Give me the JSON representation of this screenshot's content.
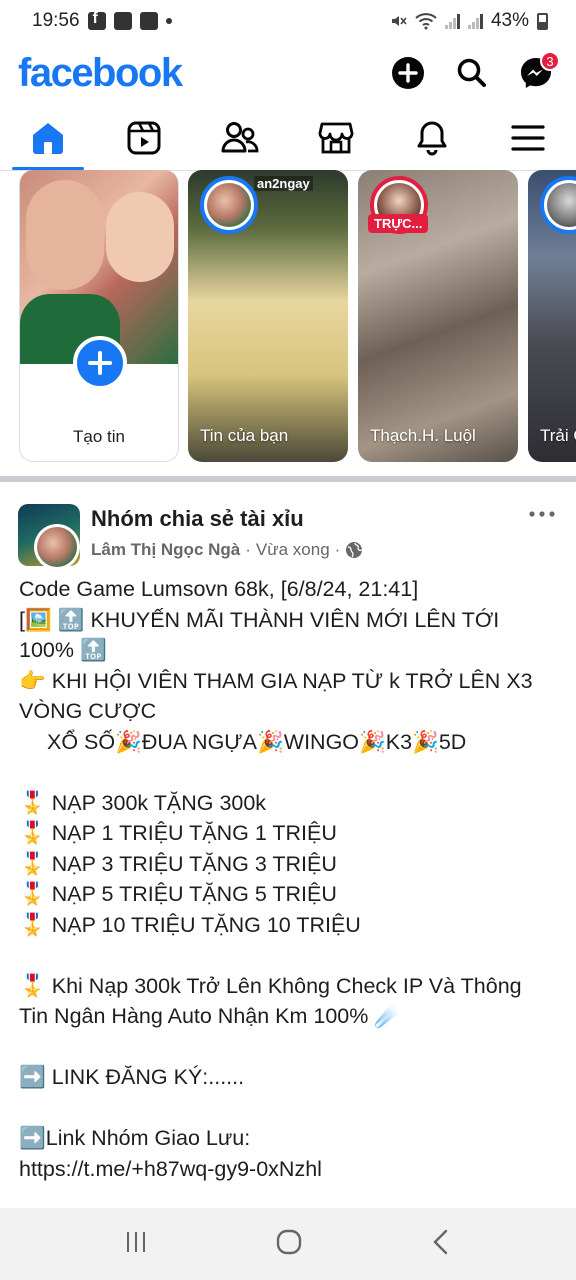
{
  "status_bar": {
    "time": "19:56",
    "battery": "43%"
  },
  "header": {
    "logo": "facebook",
    "messenger_badge": "3"
  },
  "stories": {
    "create_label": "Tạo tin",
    "items": [
      {
        "label": "Tin của bạn",
        "watermark": "an2ngay"
      },
      {
        "label": "Thạch.H. Luộl",
        "live": "TRỰC..."
      },
      {
        "label": "Trải C"
      }
    ]
  },
  "post": {
    "group_name": "Nhóm chia sẻ tài xỉu",
    "author": "Lâm Thị Ngọc Ngà",
    "time": "Vừa xong",
    "lines": [
      "Code Game Lumsovn 68k, [6/8/24, 21:41]",
      "[🖼️ 🔝 KHUYẾN MÃI THÀNH VIÊN MỚI LÊN TỚI",
      "100% 🔝",
      "👉 KHI HỘI VIÊN THAM GIA NẠP TỪ k TRỞ LÊN X3",
      "VÒNG CƯỢC",
      "XỔ SỐ🎉ĐUA NGỰA🎉WINGO🎉K3🎉5D",
      "",
      "🎖️ NẠP 300k TẶNG 300k",
      "🎖️ NẠP 1 TRIỆU TẶNG 1 TRIỆU",
      "🎖️ NẠP 3 TRIỆU TẶNG 3 TRIỆU",
      "🎖️ NẠP 5 TRIỆU TẶNG 5 TRIỆU",
      "🎖️ NẠP 10 TRIỆU TẶNG 10 TRIỆU",
      "",
      "🎖️ Khi Nạp 300k Trở Lên Không Check IP Và Thông",
      "Tin Ngân Hàng Auto Nhận Km 100% ☄️",
      "",
      "➡️ LINK ĐĂNG KÝ:......",
      "",
      "➡️Link Nhóm Giao Lưu:",
      "https://t.me/+h87wq-gy9-0xNzhl"
    ]
  },
  "colors": {
    "brand": "#1877f2",
    "badge": "#e41e3f",
    "muted_text": "#65676b"
  }
}
